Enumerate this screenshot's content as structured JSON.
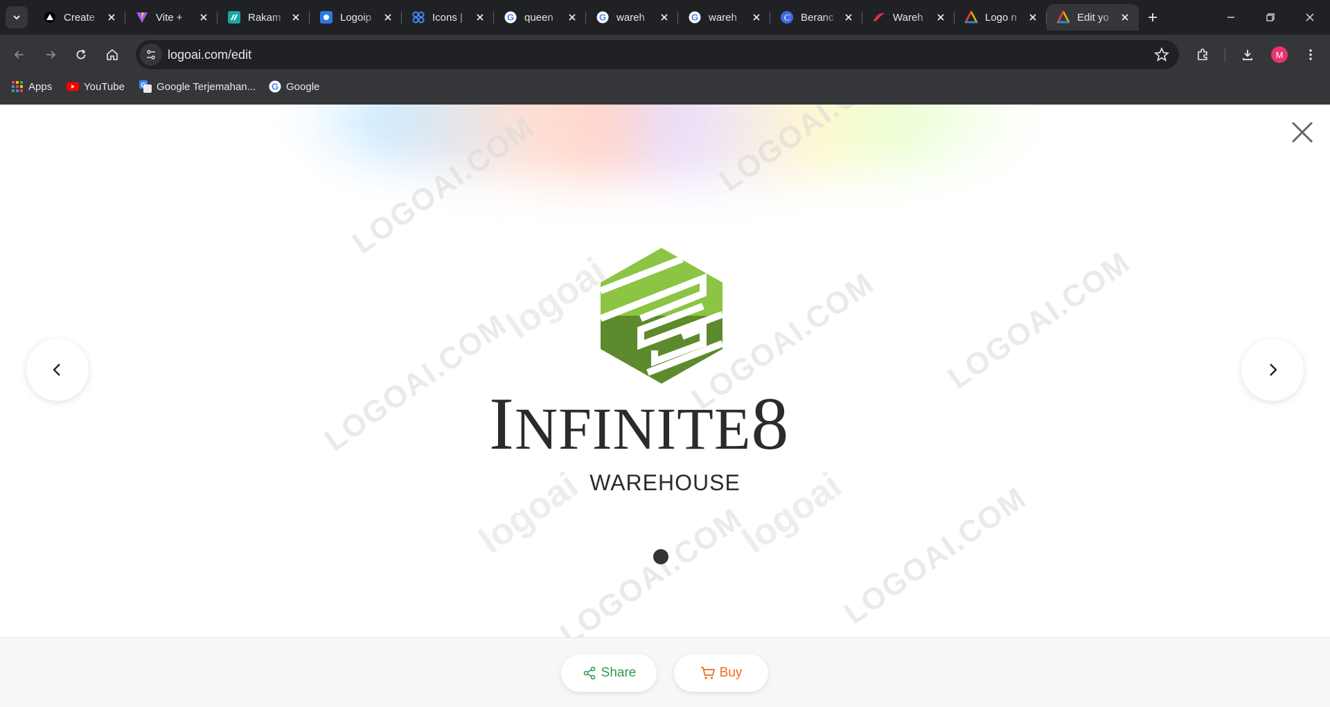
{
  "browser": {
    "tabs": [
      {
        "title": "Create",
        "icon": "vercel-triangle-icon"
      },
      {
        "title": "Vite +",
        "icon": "vite-icon"
      },
      {
        "title": "Rakam",
        "icon": "rakamin-icon"
      },
      {
        "title": "Logoip",
        "icon": "logoipsum-icon"
      },
      {
        "title": "Icons |",
        "icon": "icons-site-icon"
      },
      {
        "title": "queen",
        "icon": "google-icon"
      },
      {
        "title": "wareh",
        "icon": "google-icon"
      },
      {
        "title": "wareh",
        "icon": "google-icon"
      },
      {
        "title": "Beranc",
        "icon": "canva-icon"
      },
      {
        "title": "Wareh",
        "icon": "red-swoosh-icon"
      },
      {
        "title": "Logo n",
        "icon": "logoai-icon"
      },
      {
        "title": "Edit yo",
        "icon": "logoai-icon",
        "active": true
      }
    ],
    "url": "logoai.com/edit",
    "profile_initial": "M",
    "bookmarks": [
      {
        "label": "Apps",
        "icon": "apps-grid-icon"
      },
      {
        "label": "YouTube",
        "icon": "youtube-icon"
      },
      {
        "label": "Google Terjemahan...",
        "icon": "google-translate-icon"
      },
      {
        "label": "Google",
        "icon": "google-icon"
      }
    ]
  },
  "page": {
    "brand": {
      "name_first": "I",
      "name_mid": "NFINITE",
      "name_last": "8",
      "tagline": "WAREHOUSE",
      "colors": {
        "light_green": "#8cc444",
        "dark_green": "#5c8a2c",
        "text": "#2b2b2b"
      }
    },
    "watermark_text": "LOGOAI.COM",
    "watermark_brand": "logoai",
    "actions": {
      "share_label": "Share",
      "buy_label": "Buy",
      "share_color": "#2e9a52",
      "buy_color": "#ef6b1f"
    }
  }
}
